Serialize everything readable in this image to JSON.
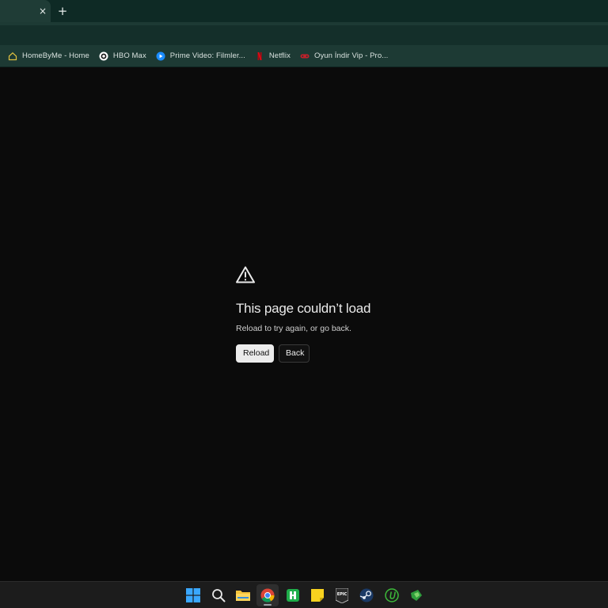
{
  "tabs": {
    "close_glyph": "×",
    "new_tab_glyph": "+"
  },
  "bookmarks": [
    {
      "label": "HomeByMe - Home",
      "icon": "house-icon",
      "color": "#e0c040"
    },
    {
      "label": "HBO Max",
      "icon": "hbo-icon",
      "color": "#ffffff"
    },
    {
      "label": "Prime Video: Filmler...",
      "icon": "prime-video-icon",
      "color": "#1a8cff"
    },
    {
      "label": "Netflix",
      "icon": "netflix-icon",
      "color": "#e50914"
    },
    {
      "label": "Oyun İndir Vip - Pro...",
      "icon": "gamepad-icon",
      "color": "#c0202a"
    }
  ],
  "error": {
    "title": "This page couldn’t load",
    "message": "Reload to try again, or go back.",
    "reload_label": "Reload",
    "back_label": "Back"
  },
  "taskbar": {
    "items": [
      {
        "name": "windows-start-icon"
      },
      {
        "name": "search-icon"
      },
      {
        "name": "file-explorer-icon"
      },
      {
        "name": "chrome-icon",
        "active": true
      },
      {
        "name": "green-app-icon"
      },
      {
        "name": "sticky-notes-icon"
      },
      {
        "name": "epic-games-icon",
        "text": "EPIC"
      },
      {
        "name": "steam-icon"
      },
      {
        "name": "utorrent-icon"
      },
      {
        "name": "green-launcher-icon"
      }
    ]
  }
}
